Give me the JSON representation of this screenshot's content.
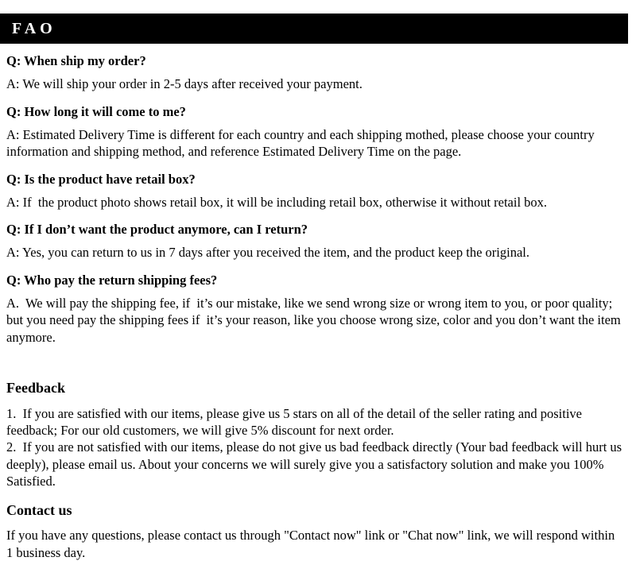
{
  "header": {
    "title": "FAO",
    "background_color": "#000000",
    "text_color": "#ffffff"
  },
  "faq": {
    "items": [
      {
        "question": "Q: When ship my order?",
        "answer": "A: We will ship your order in 2-5 days after received your payment."
      },
      {
        "question": "Q: How long it will come to me?",
        "answer": "A: Estimated Delivery Time is different for each country and each shipping mothed, please choose your country information and shipping method, and reference Estimated Delivery Time on the page."
      },
      {
        "question": "Q: Is the product have retail box?",
        "answer": "A: If  the product photo shows retail box, it will be including retail box, otherwise it without retail box."
      },
      {
        "question": "Q: If I don’t want the product anymore, can I return?",
        "answer": "A: Yes, you can return to us in 7 days after you received the item, and the product keep the original."
      },
      {
        "question": "Q: Who pay the return shipping fees?",
        "answer": "A.  We will pay the shipping fee, if  it’s our mistake, like we send wrong size or wrong item to you, or poor quality; but you need pay the shipping fees if  it’s your reason, like you choose wrong size, color and you don’t want the item anymore."
      }
    ]
  },
  "feedback": {
    "heading": "Feedback",
    "paragraphs": [
      "1.  If you are satisfied with our items, please give us 5 stars on all of the detail of the seller rating and positive feedback; For our old customers, we will give 5% discount for next order.",
      "2.  If you are not satisfied with our items, please do not give us bad feedback directly (Your bad feedback will hurt us deeply), please email us. About your concerns we will surely give you a satisfactory solution and make you 100% Satisfied."
    ]
  },
  "contact": {
    "heading": "Contact us",
    "paragraphs": [
      "If you have any questions, please contact us through \"Contact now\" link or \"Chat now\" link, we will respond within 1 business day."
    ]
  }
}
